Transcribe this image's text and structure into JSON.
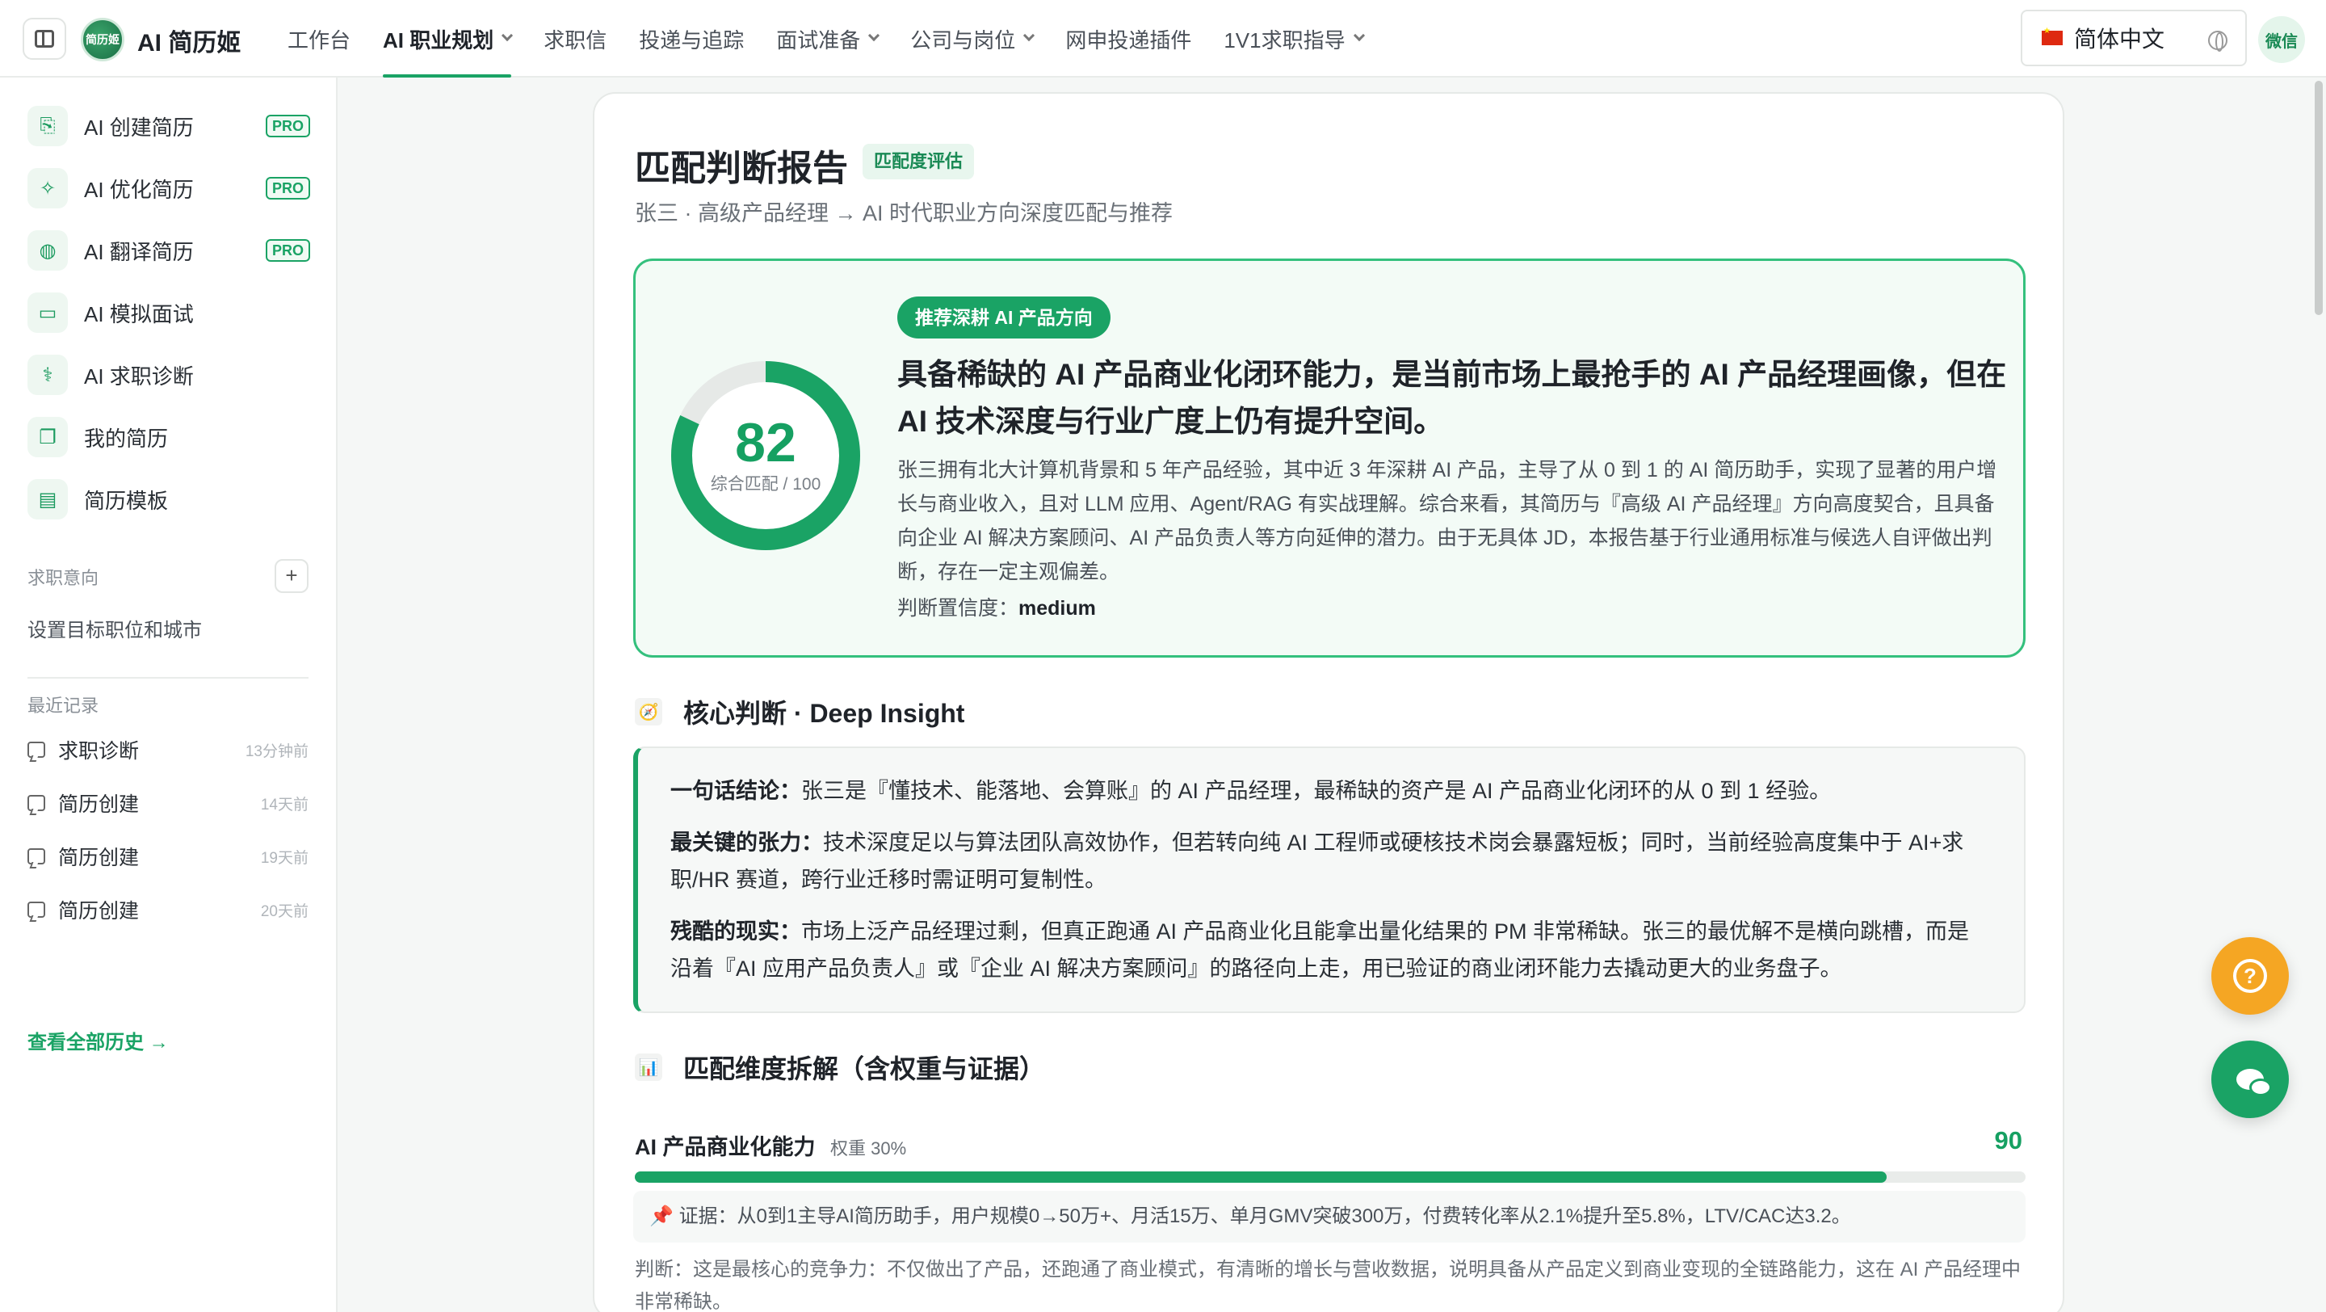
{
  "app": {
    "name": "AI 简历姬",
    "logo_text": "简历姬"
  },
  "nav": {
    "items": [
      {
        "label": "工作台",
        "dropdown": false,
        "active": false
      },
      {
        "label": "AI 职业规划",
        "dropdown": true,
        "active": true
      },
      {
        "label": "求职信",
        "dropdown": false,
        "active": false
      },
      {
        "label": "投递与追踪",
        "dropdown": false,
        "active": false
      },
      {
        "label": "面试准备",
        "dropdown": true,
        "active": false
      },
      {
        "label": "公司与岗位",
        "dropdown": true,
        "active": false
      },
      {
        "label": "网申投递插件",
        "dropdown": false,
        "active": false
      },
      {
        "label": "1V1求职指导",
        "dropdown": true,
        "active": false
      }
    ],
    "language": "简体中文",
    "wechat": "微信"
  },
  "sidebar": {
    "items": [
      {
        "label": "AI 创建简历",
        "icon": "file-plus-icon",
        "pro": "PRO"
      },
      {
        "label": "AI 优化简历",
        "icon": "magic-wand-icon",
        "pro": "PRO"
      },
      {
        "label": "AI 翻译简历",
        "icon": "globe-icon",
        "pro": "PRO"
      },
      {
        "label": "AI 模拟面试",
        "icon": "video-icon",
        "pro": ""
      },
      {
        "label": "AI 求职诊断",
        "icon": "stethoscope-icon",
        "pro": ""
      },
      {
        "label": "我的简历",
        "icon": "copy-icon",
        "pro": ""
      },
      {
        "label": "简历模板",
        "icon": "layout-icon",
        "pro": ""
      }
    ],
    "intent_title": "求职意向",
    "intent_link": "设置目标职位和城市",
    "recent_title": "最近记录",
    "history": [
      {
        "label": "求职诊断",
        "time": "13分钟前"
      },
      {
        "label": "简历创建",
        "time": "14天前"
      },
      {
        "label": "简历创建",
        "time": "19天前"
      },
      {
        "label": "简历创建",
        "time": "20天前"
      }
    ],
    "view_all": "查看全部历史 →"
  },
  "report": {
    "title": "匹配判断报告",
    "title_tag": "匹配度评估",
    "subtitle": "张三 · 高级产品经理 → AI 时代职业方向深度匹配与推荐",
    "score": 82,
    "score_max": 100,
    "score_label": "综合匹配 / 100",
    "hero_tag": "推荐深耕 AI 产品方向",
    "headline": "具备稀缺的 AI 产品商业化闭环能力，是当前市场上最抢手的 AI 产品经理画像，但在 AI 技术深度与行业广度上仍有提升空间。",
    "summary": "张三拥有北大计算机背景和 5 年产品经验，其中近 3 年深耕 AI 产品，主导了从 0 到 1 的 AI 简历助手，实现了显著的用户增长与商业收入，且对 LLM 应用、Agent/RAG 有实战理解。综合来看，其简历与『高级 AI 产品经理』方向高度契合，且具备向企业 AI 解决方案顾问、AI 产品负责人等方向延伸的潜力。由于无具体 JD，本报告基于行业通用标准与候选人自评做出判断，存在一定主观偏差。",
    "confidence_label": "判断置信度：",
    "confidence_value": "medium",
    "insight_title": "核心判断 · Deep Insight",
    "insights": [
      {
        "label": "一句话结论：",
        "text": "张三是『懂技术、能落地、会算账』的 AI 产品经理，最稀缺的资产是 AI 产品商业化闭环的从 0 到 1 经验。"
      },
      {
        "label": "最关键的张力：",
        "text": "技术深度足以与算法团队高效协作，但若转向纯 AI 工程师或硬核技术岗会暴露短板；同时，当前经验高度集中于 AI+求职/HR 赛道，跨行业迁移时需证明可复制性。"
      },
      {
        "label": "残酷的现实：",
        "text": "市场上泛产品经理过剩，但真正跑通 AI 产品商业化且能拿出量化结果的 PM 非常稀缺。张三的最优解不是横向跳槽，而是沿着『AI 应用产品负责人』或『企业 AI 解决方案顾问』的路径向上走，用已验证的商业闭环能力去撬动更大的业务盘子。"
      }
    ],
    "dimension_title": "匹配维度拆解（含权重与证据）",
    "dimension": {
      "name": "AI 产品商业化能力",
      "weight": "权重 30%",
      "score": 90,
      "evidence": "证据：从0到1主导AI简历助手，用户规模0→50万+、月活15万、单月GMV突破300万，付费转化率从2.1%提升至5.8%，LTV/CAC达3.2。",
      "judgment": "判断：这是最核心的竞争力：不仅做出了产品，还跑通了商业模式，有清晰的增长与营收数据，说明具备从产品定义到商业变现的全链路能力，这在 AI 产品经理中非常稀缺。"
    }
  },
  "colors": {
    "accent": "#1aa365",
    "help": "#f5a623"
  }
}
